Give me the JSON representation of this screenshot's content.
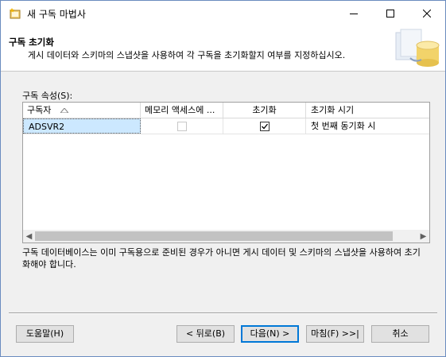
{
  "window": {
    "title": "새 구독 마법사"
  },
  "header": {
    "title": "구독 초기화",
    "subtitle": "게시 데이터와 스키마의 스냅샷을 사용하여 각 구독을 초기화할지 여부를 지정하십시오."
  },
  "properties_label": "구독 속성(S):",
  "grid": {
    "columns": [
      "구독자",
      "메모리 액세스에 ...",
      "초기화",
      "초기화 시기"
    ],
    "rows": [
      {
        "subscriber": "ADSVR2",
        "memory_access": false,
        "initialize": true,
        "init_when": "첫 번째 동기화 시"
      }
    ]
  },
  "description": "구독 데이터베이스는 이미 구독용으로 준비된 경우가 아니면 게시 데이터 및 스키마의 스냅샷을 사용하여 초기화해야 합니다.",
  "buttons": {
    "help": "도움말(H)",
    "back": "< 뒤로(B)",
    "next": "다음(N) >",
    "finish": "마침(F) >>|",
    "cancel": "취소"
  },
  "colors": {
    "selection": "#cce8ff",
    "accent": "#0078d7"
  }
}
